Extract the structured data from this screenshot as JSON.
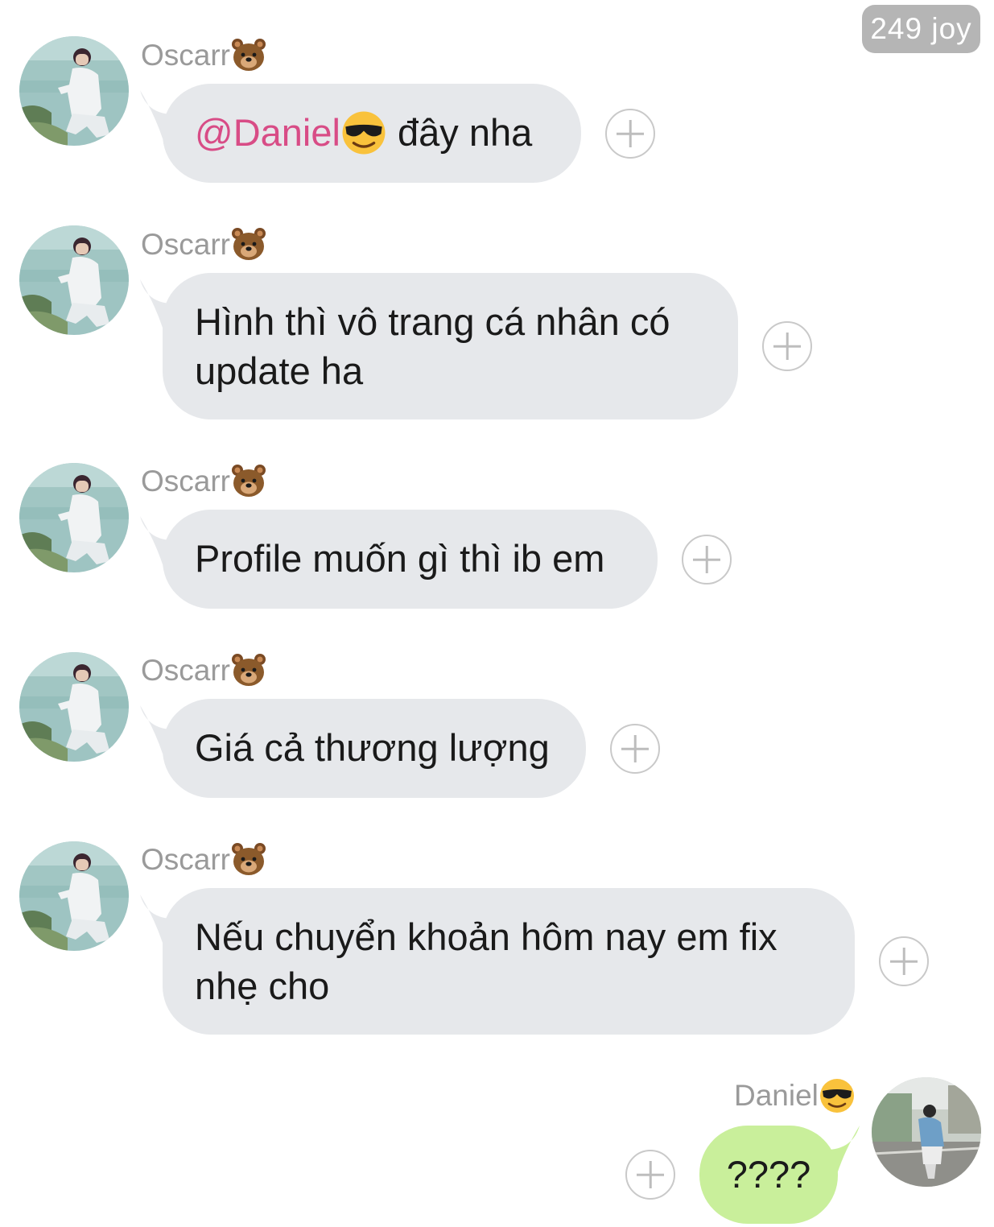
{
  "badge": {
    "text": "249 joy"
  },
  "messages": [
    {
      "sender": "Oscarr",
      "sender_emoji": "bear-emoji",
      "mention": "@Daniel",
      "mention_emoji": "sunglasses-emoji",
      "text": " đây nha"
    },
    {
      "sender": "Oscarr",
      "sender_emoji": "bear-emoji",
      "line1": "Hình thì vô trang cá nhân có",
      "line2": "update ha"
    },
    {
      "sender": "Oscarr",
      "sender_emoji": "bear-emoji",
      "text": "Profile muốn gì thì ib em"
    },
    {
      "sender": "Oscarr",
      "sender_emoji": "bear-emoji",
      "text": "Giá cả thương lượng"
    },
    {
      "sender": "Oscarr",
      "sender_emoji": "bear-emoji",
      "line1": "Nếu chuyển khoản hôm nay em fix",
      "line2": "nhẹ cho"
    }
  ],
  "outgoing": {
    "sender": "Daniel",
    "sender_emoji": "sunglasses-emoji",
    "text": "????"
  },
  "colors": {
    "incoming_bubble": "#e6e8eb",
    "outgoing_bubble": "#c9ef9b",
    "mention": "#d84c86",
    "sender_name": "#9a9a9a",
    "badge": "#b5b5b5"
  }
}
